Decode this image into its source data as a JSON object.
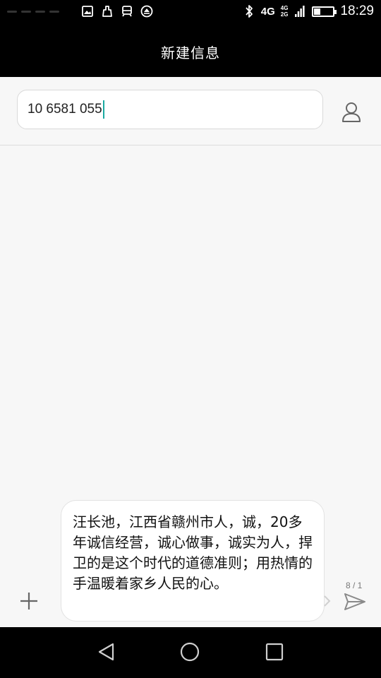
{
  "status_bar": {
    "network": "4G",
    "network_secondary_top": "4G",
    "network_secondary_bottom": "2G",
    "time": "18:29",
    "battery_level": 0.32,
    "icons": [
      "image-icon",
      "cleaner-icon",
      "train-icon",
      "app-icon",
      "bluetooth-icon",
      "signal-icon",
      "battery-icon"
    ]
  },
  "header": {
    "title": "新建信息"
  },
  "recipient": {
    "value": "10 6581 055",
    "icon": "contact-icon"
  },
  "composer": {
    "message": "汪长池，江西省赣州市人，诚，20多年诚信经营，诚心做事，诚实为人，捍卫的是这个时代的道德准则；用热情的手温暖着家乡人民的心。",
    "char_count": "8 / 1",
    "add_icon": "plus-icon",
    "send_icon": "send-icon"
  },
  "nav_bar": {
    "icons": [
      "back-icon",
      "home-icon",
      "recents-icon"
    ]
  },
  "colors": {
    "caret": "#1aa9a0",
    "background": "#f7f7f7",
    "bars": "#000000"
  }
}
